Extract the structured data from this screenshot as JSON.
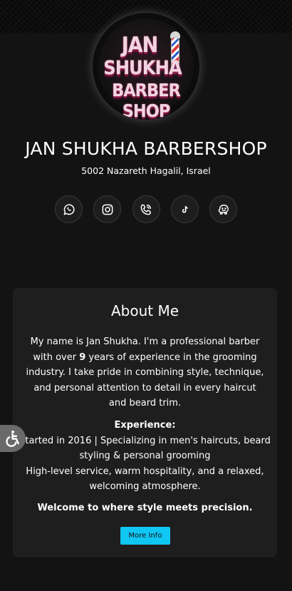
{
  "header": {
    "logo_text_lines": [
      "JAN",
      "SHUKHA",
      "BARBER SHOP"
    ],
    "title": "JAN SHUKHA BARBERSHOP",
    "address": "5002 Nazareth Hagalil, Israel"
  },
  "social": [
    {
      "name": "whatsapp",
      "icon": "whatsapp-icon"
    },
    {
      "name": "instagram",
      "icon": "instagram-icon"
    },
    {
      "name": "phone",
      "icon": "phone-icon"
    },
    {
      "name": "tiktok",
      "icon": "tiktok-icon"
    },
    {
      "name": "waze",
      "icon": "waze-icon"
    }
  ],
  "about": {
    "title": "About Me",
    "intro_before": "My name is Jan Shukha. I'm a professional barber with over ",
    "years": "9",
    "intro_after": " years of experience in the grooming industry. I take pride in combining style, technique, and personal attention to detail in every haircut and beard trim.",
    "experience_heading": "Experience:",
    "experience_line1": "Started in 2016 | Specializing in men's haircuts, beard styling & personal grooming",
    "experience_line2": "High-level service, warm hospitality, and a relaxed, welcoming atmosphere.",
    "welcome": "Welcome to where style meets precision.",
    "button_label": "More Info"
  },
  "colors": {
    "background": "#131313",
    "card": "#1e1e1e",
    "accent_button": "#10c6f2",
    "accessibility_tab": "#6a6a6a"
  }
}
